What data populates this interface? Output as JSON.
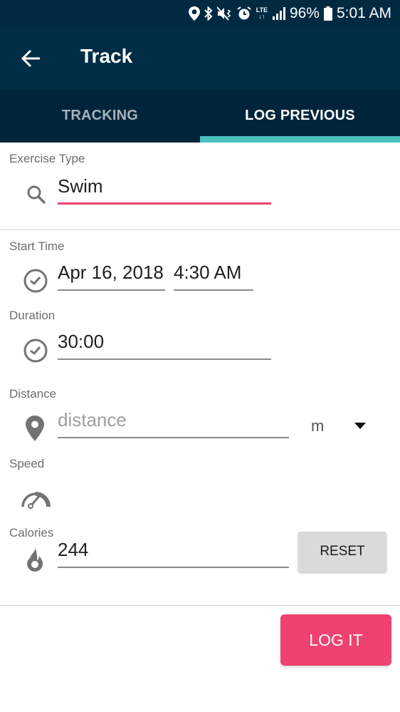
{
  "status_bar": {
    "icons": [
      "location-icon",
      "bluetooth-icon",
      "mute-vibrate-icon",
      "alarm-icon",
      "lte-icon",
      "signal-icon",
      "battery-icon"
    ],
    "network": "LTE",
    "battery": "96%",
    "time": "5:01 AM"
  },
  "app_bar": {
    "back_icon": "arrow-left-icon",
    "title": "Track"
  },
  "tabs": [
    {
      "label": "TRACKING",
      "selected": false
    },
    {
      "label": "LOG PREVIOUS",
      "selected": true
    }
  ],
  "colors": {
    "app_bar": "#002d46",
    "tab_bar": "#00243a",
    "tab_indicator": "#4bc1bf",
    "accent": "#ef426f",
    "reset_button": "#d9dad9"
  },
  "form": {
    "exercise_type": {
      "label": "Exercise Type",
      "icon": "search-icon",
      "value": "Swim"
    },
    "start_time": {
      "label": "Start Time",
      "icon": "clock-icon",
      "date": "Apr 16, 2018",
      "time": "4:30 AM"
    },
    "duration": {
      "label": "Duration",
      "icon": "clock-icon",
      "value": "30:00"
    },
    "distance": {
      "label": "Distance",
      "icon": "location-pin-icon",
      "value": "",
      "placeholder": "distance",
      "unit": "m"
    },
    "speed": {
      "label": "Speed",
      "icon": "speedometer-icon"
    },
    "calories": {
      "label": "Calories",
      "icon": "flame-icon",
      "value": "244"
    }
  },
  "buttons": {
    "reset": "RESET",
    "log_it": "LOG IT"
  }
}
